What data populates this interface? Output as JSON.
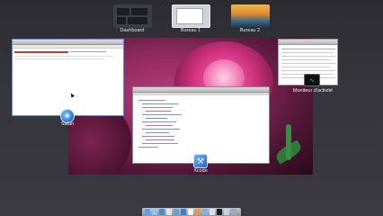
{
  "spaces": [
    {
      "label": "Dashboard"
    },
    {
      "label": "Bureau 1"
    },
    {
      "label": "Bureau 2"
    }
  ],
  "windows": {
    "safari": {
      "app_label": "Safari",
      "icon": "compass-icon"
    },
    "xcode": {
      "app_label": "Xcode",
      "icon": "hammer-icon"
    },
    "activity_monitor": {
      "app_label": "Moniteur d'activité",
      "icon": "activity-monitor-icon"
    }
  },
  "colors": {
    "selection_border": "#5c8ee6",
    "wallpaper_accent": "#b43b7b"
  }
}
